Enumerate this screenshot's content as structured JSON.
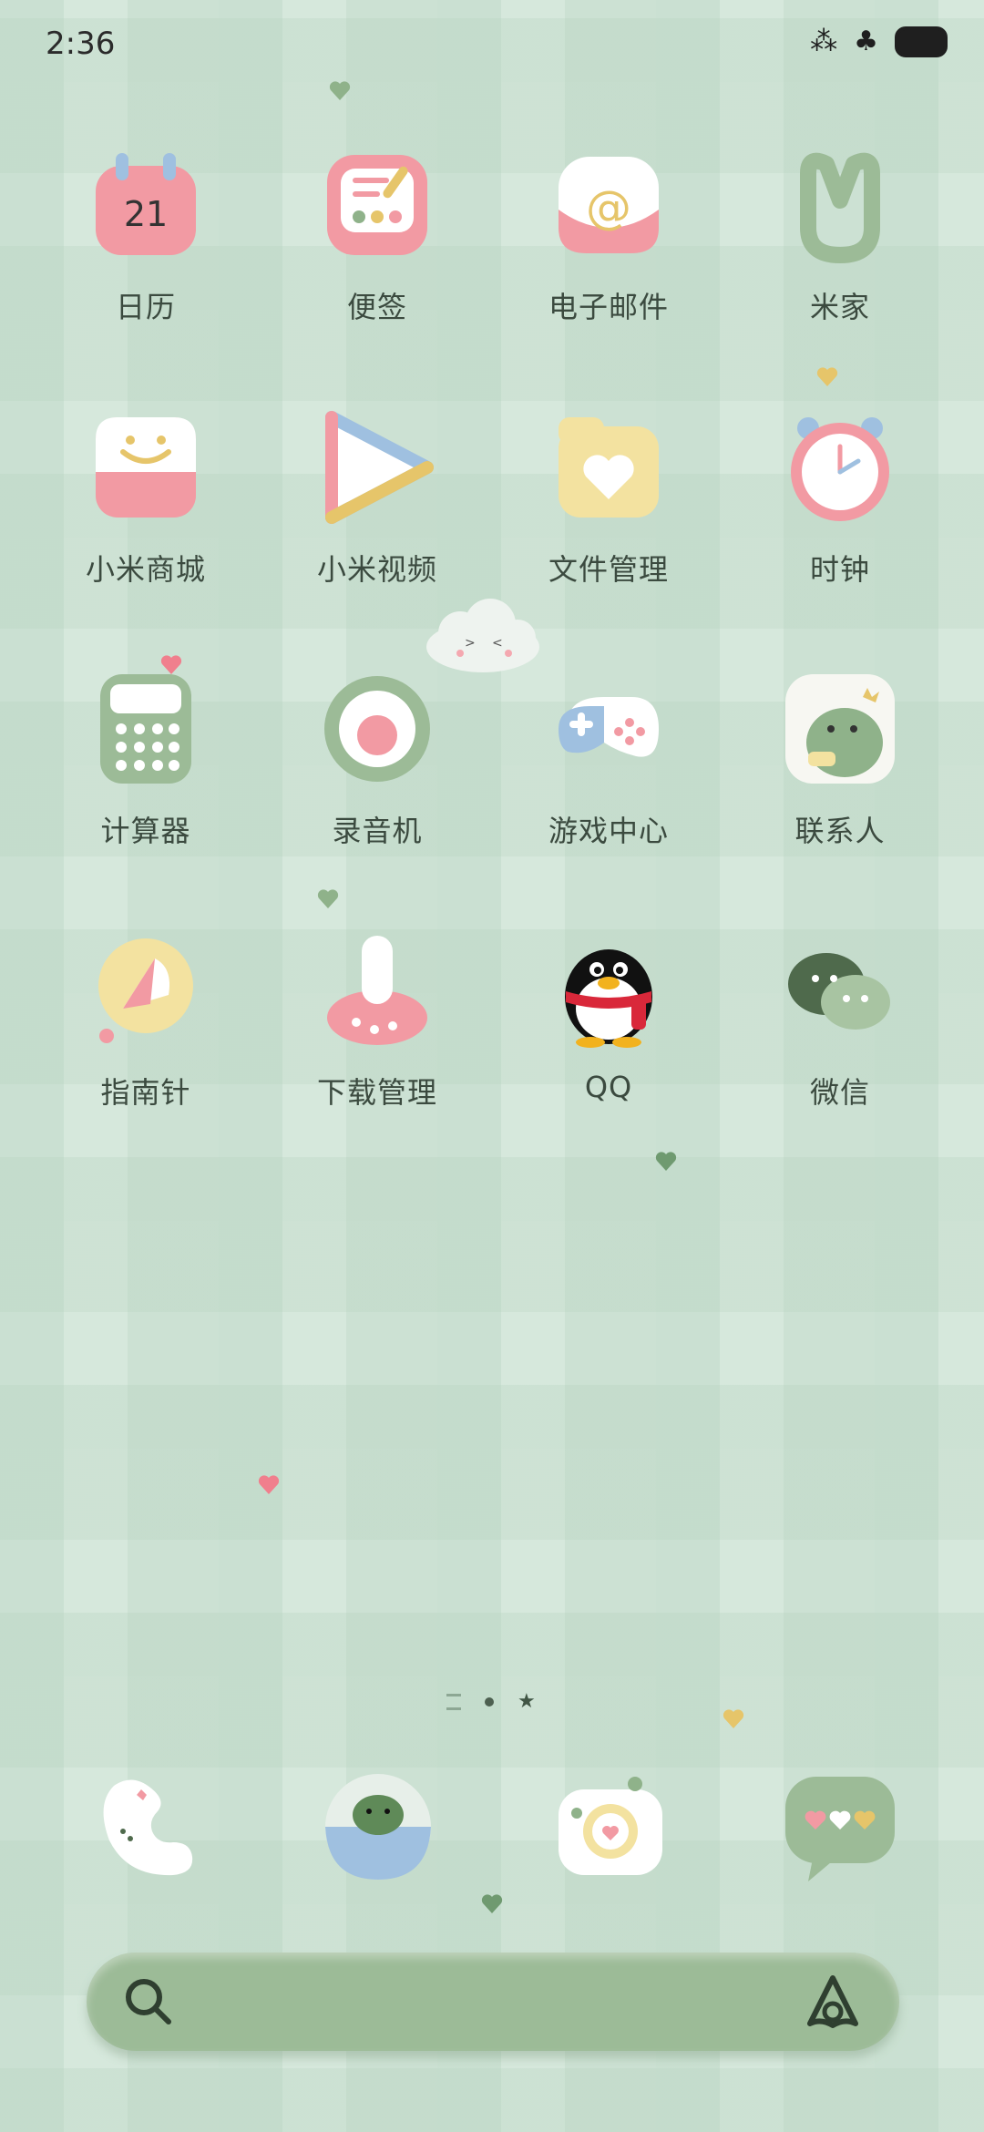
{
  "status_bar": {
    "time": "2:36"
  },
  "apps": [
    {
      "id": "calendar",
      "label": "日历",
      "badge": "21"
    },
    {
      "id": "notes",
      "label": "便签"
    },
    {
      "id": "email",
      "label": "电子邮件"
    },
    {
      "id": "mi-home",
      "label": "米家"
    },
    {
      "id": "mi-store",
      "label": "小米商城"
    },
    {
      "id": "mi-video",
      "label": "小米视频"
    },
    {
      "id": "file-manager",
      "label": "文件管理"
    },
    {
      "id": "clock",
      "label": "时钟"
    },
    {
      "id": "calculator",
      "label": "计算器"
    },
    {
      "id": "recorder",
      "label": "录音机"
    },
    {
      "id": "game-center",
      "label": "游戏中心"
    },
    {
      "id": "contacts",
      "label": "联系人"
    },
    {
      "id": "compass",
      "label": "指南针"
    },
    {
      "id": "downloads",
      "label": "下载管理"
    },
    {
      "id": "qq",
      "label": "QQ"
    },
    {
      "id": "wechat",
      "label": "微信"
    }
  ],
  "dock": [
    {
      "id": "phone",
      "icon": "phone-icon"
    },
    {
      "id": "browser",
      "icon": "dino-globe-icon"
    },
    {
      "id": "camera",
      "icon": "camera-icon"
    },
    {
      "id": "messages",
      "icon": "chat-bubble-icon"
    }
  ],
  "page_indicator": {
    "pages": 3,
    "current": 3
  },
  "colors": {
    "background": "#d6e8dc",
    "search_bar": "#9cbb97",
    "pink": "#f29aa3",
    "green": "#8fb28a",
    "cream": "#f3eabf",
    "blue": "#9fc0e0"
  }
}
